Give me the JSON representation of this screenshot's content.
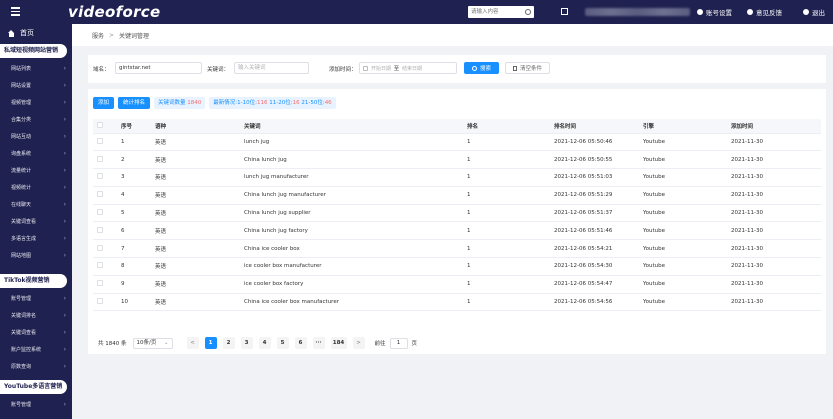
{
  "header": {
    "logo": "videoforce",
    "search_placeholder": "请输入内容",
    "account_settings": "账号设置",
    "feedback": "意见反馈",
    "logout": "退出"
  },
  "sidebar": {
    "home": "首页",
    "groups": [
      {
        "label": "私域短视频网站营销",
        "items": [
          "网站列表",
          "网站设置",
          "视频管理",
          "合集分类",
          "网站互动",
          "询盘系统",
          "流量统计",
          "视频统计",
          "在线聊天",
          "关键词查看",
          "多语言生成",
          "网站地图"
        ]
      },
      {
        "label": "TikTok视频营销",
        "items": [
          "账号管理",
          "关键词排名",
          "关键词查看",
          "账户监控系统",
          "原数查询"
        ]
      },
      {
        "label": "YouTube多语言营销",
        "items": [
          "账号管理"
        ]
      }
    ]
  },
  "breadcrumb": {
    "root": "服务",
    "sep": ">",
    "current": "关键词管理"
  },
  "filter": {
    "domain_label": "域名：",
    "domain_value": "gintstar.net",
    "keyword_label": "关键词：",
    "keyword_placeholder": "输入关键词",
    "date_label": "添加时间：",
    "date_start_placeholder": "开始日期",
    "date_sep": "至",
    "date_end_placeholder": "结束日期",
    "search_btn": "搜索",
    "clear_btn": "清空条件"
  },
  "toolbar": {
    "add_btn": "添加",
    "rank_btn": "统计排名",
    "kw_count_label": "关键词数量",
    "kw_count": "1840",
    "rank_label": "最新情况:1-10位:",
    "rank_1_10": "116",
    "rank_11_20_label": "11-20位:",
    "rank_11_20": "16",
    "rank_21_50_label": "21-50位:",
    "rank_21_50": "46"
  },
  "table": {
    "columns": [
      "序号",
      "语种",
      "关键词",
      "排名",
      "排名时间",
      "引擎",
      "添加时间"
    ],
    "rows": [
      [
        "1",
        "英语",
        "lunch jug",
        "1",
        "2021-12-06 05:50:46",
        "Youtube",
        "2021-11-30"
      ],
      [
        "2",
        "英语",
        "China lunch jug",
        "1",
        "2021-12-06 05:50:55",
        "Youtube",
        "2021-11-30"
      ],
      [
        "3",
        "英语",
        "lunch jug manufacturer",
        "1",
        "2021-12-06 05:51:03",
        "Youtube",
        "2021-11-30"
      ],
      [
        "4",
        "英语",
        "China lunch jug manufacturer",
        "1",
        "2021-12-06 05:51:29",
        "Youtube",
        "2021-11-30"
      ],
      [
        "5",
        "英语",
        "China lunch jug supplier",
        "1",
        "2021-12-06 05:51:37",
        "Youtube",
        "2021-11-30"
      ],
      [
        "6",
        "英语",
        "China lunch jug factory",
        "1",
        "2021-12-06 05:51:46",
        "Youtube",
        "2021-11-30"
      ],
      [
        "7",
        "英语",
        "China ice cooler box",
        "1",
        "2021-12-06 05:54:21",
        "Youtube",
        "2021-11-30"
      ],
      [
        "8",
        "英语",
        "ice cooler box manufacturer",
        "1",
        "2021-12-06 05:54:30",
        "Youtube",
        "2021-11-30"
      ],
      [
        "9",
        "英语",
        "ice cooler box factory",
        "1",
        "2021-12-06 05:54:47",
        "Youtube",
        "2021-11-30"
      ],
      [
        "10",
        "英语",
        "China ice cooler box manufacturer",
        "1",
        "2021-12-06 05:54:56",
        "Youtube",
        "2021-11-30"
      ]
    ]
  },
  "pagination": {
    "total": "共 1840 条",
    "page_size": "10条/页",
    "prev": "<",
    "pages": [
      "1",
      "2",
      "3",
      "4",
      "5",
      "6",
      "···",
      "184"
    ],
    "current_page": "1",
    "next": ">",
    "goto_label": "前往",
    "goto_value": "1",
    "goto_suffix": "页"
  },
  "colors": {
    "primary": "#1890ff",
    "nav_bg": "#1f2150",
    "highlight": "#f56c6c"
  }
}
